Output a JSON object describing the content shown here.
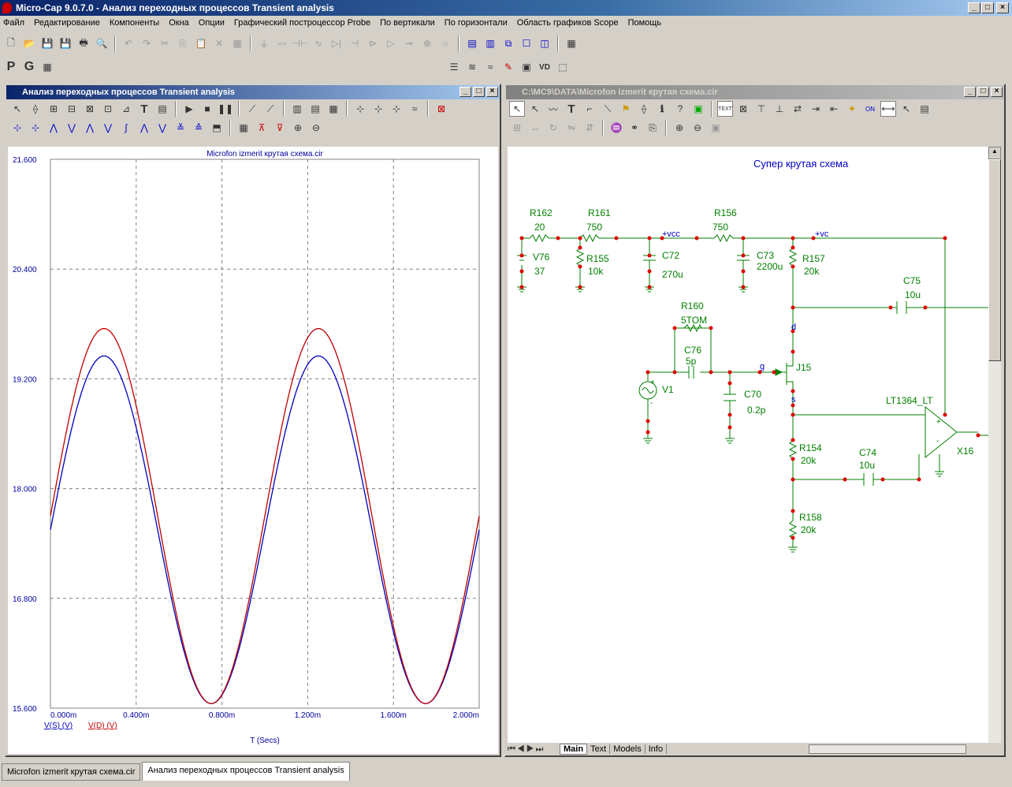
{
  "app": {
    "title": "Micro-Cap 9.0.7.0 - Анализ переходных процессов Transient analysis"
  },
  "menu": [
    "Файл",
    "Редактирование",
    "Компоненты",
    "Окна",
    "Опции",
    "Графический построцессор Probe",
    "По вертикали",
    "По горизонтали",
    "Область графиков Scope",
    "Помощь"
  ],
  "toolbar2": {
    "p": "P",
    "g": "G"
  },
  "left_panel": {
    "title": "Анализ переходных процессов Transient analysis"
  },
  "right_panel": {
    "title": "C:\\MC9\\DATA\\Microfon izmerit крутая схема.cir"
  },
  "chart_data": {
    "type": "line",
    "title": "Microfon izmerit крутая схема.cir",
    "xlabel": "T (Secs)",
    "x_ticks": [
      "0.000m",
      "0.400m",
      "0.800m",
      "1.200m",
      "1.600m",
      "2.000m"
    ],
    "y_ticks": [
      "21.600",
      "20.400",
      "19.200",
      "18.000",
      "16.800",
      "15.600"
    ],
    "xlim": [
      0,
      2.0
    ],
    "ylim": [
      15.6,
      21.6
    ],
    "grid": true,
    "series": [
      {
        "name": "V(S) (V)",
        "color": "#0000c0",
        "offset": 17.55,
        "amplitude": 1.9
      },
      {
        "name": "V(D) (V)",
        "color": "#c00000",
        "offset": 17.7,
        "amplitude": 2.05
      }
    ],
    "period_ms": 1.0,
    "peak_ms": 0.25
  },
  "schematic": {
    "title": "Супер крутая схема",
    "labels": {
      "r162": "R162",
      "r162v": "20",
      "r161": "R161",
      "r161v": "750",
      "r156": "R156",
      "r156v": "750",
      "vcc": "+vcc",
      "vc": "+vc",
      "v76": "V76",
      "v76v": "37",
      "r155": "R155",
      "r155v": "10k",
      "c72": "C72",
      "c72v": "270u",
      "c73": "C73",
      "c73v": "2200u",
      "r157": "R157",
      "r157v": "20k",
      "c75": "C75",
      "c75v": "10u",
      "r160": "R160",
      "r160v": "5TOM",
      "c76": "C76",
      "c76v": "5p",
      "d": "d",
      "g": "g",
      "s": "s",
      "j15": "J15",
      "v1": "V1",
      "c70": "C70",
      "c70v": "0.2p",
      "lt": "LT1364_LT",
      "x16": "X16",
      "r154": "R154",
      "r154v": "20k",
      "c74": "C74",
      "c74v": "10u",
      "r158": "R158",
      "r158v": "20k"
    }
  },
  "sheet_tabs": [
    "Main",
    "Text",
    "Models",
    "Info"
  ],
  "taskbar": [
    "Microfon izmerit крутая схема.cir",
    "Анализ переходных процессов Transient analysis"
  ],
  "colors": {
    "title_active": "#0a246a",
    "trace1": "#0000c0",
    "trace2": "#c00000",
    "schematic_text": "#008000",
    "node": "#e00000"
  }
}
